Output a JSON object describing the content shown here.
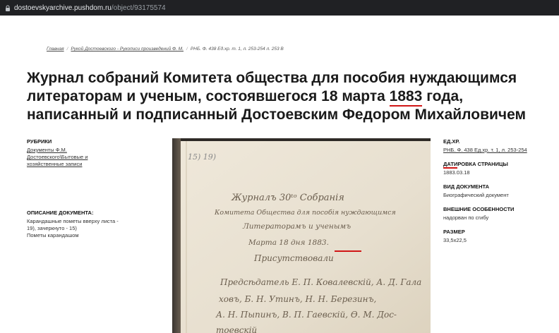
{
  "urlbar": {
    "domain": "dostoevskyarchive.pushdom.ru",
    "path": "/object/93175574"
  },
  "breadcrumb": {
    "home": "Главная",
    "section": "Рукой Достоевского - Рукописи произведений Ф. М.",
    "current": "РНБ. Ф. 438 Ед.хр. т. 1, л. 253-254 л. 253 В"
  },
  "title": {
    "part1": "Журнал собраний Комитета общества для пособия нуждающимся литераторам и ученым, состоявшегося 18 марта ",
    "year": "1883",
    "part2": " года, написанный и подписанный Достоевским Федором Михайловичем"
  },
  "left": {
    "rubrics_label": "РУБРИКИ",
    "rubrics": [
      "Документы Ф.М.",
      "Достоевского\\Бытовые и",
      "хозяйственные записи"
    ],
    "description_label": "ОПИСАНИЕ ДОКУМЕНТА:",
    "description_lines": [
      "Карандашные пометы вверху листа -",
      "19), зачеркнуто - 15)",
      "Пометы карандашом"
    ]
  },
  "manuscript": {
    "lines": [
      "15) 19)",
      "Журналъ 30ᵗᵒ Собранія",
      "Комитета Общества для пособія нуждающимся",
      "Литераторамъ и ученымъ",
      "Марта 18 дня 1883.",
      "Присутствовали",
      "Предсѣдатель Е. П. Ковалевскій, А. Д. Гала",
      "ховъ, Б. Н. Утинъ, Н. Н. Березинъ,",
      "А. Н. Пыпинъ, В. П. Гаевскій, Ѳ. М. Дос-",
      "тоевскій"
    ]
  },
  "right": {
    "items": [
      {
        "label": "ЕД.ХР.",
        "value": "РНБ. Ф. 438 Ед.хр. т. 1, л. 253-254"
      },
      {
        "label": "ДАТИРОВКА СТРАНИЦЫ",
        "value": "1883.03.18"
      },
      {
        "label": "ВИД ДОКУМЕНТА",
        "value": "Биографический документ"
      },
      {
        "label": "ВНЕШНИЕ ОСОБЕННОСТИ",
        "value": "надорван по сгибу"
      },
      {
        "label": "РАЗМЕР",
        "value": "33,5x22,5"
      }
    ]
  },
  "colors": {
    "accent_underline": "#d01616",
    "urlbar_bg": "#202124",
    "paper": "#e9e2d4"
  }
}
